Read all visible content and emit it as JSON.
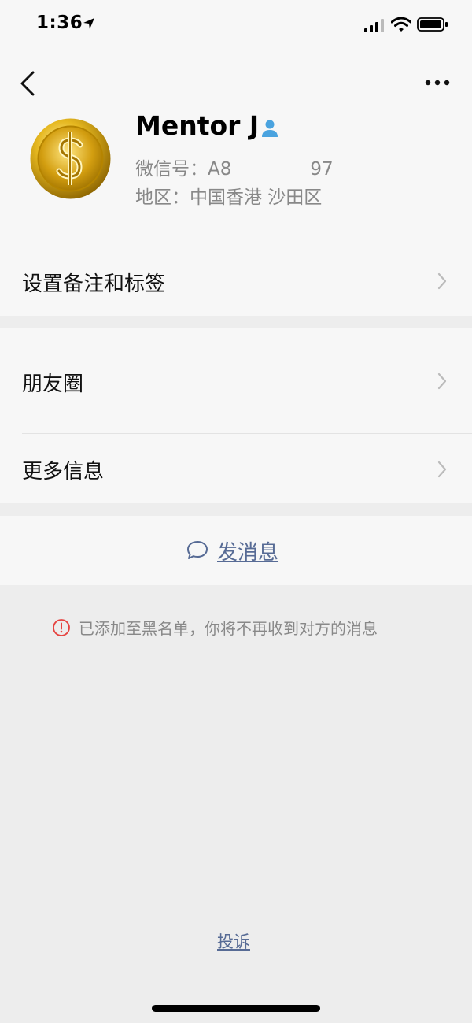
{
  "status_bar": {
    "time": "1:36"
  },
  "profile": {
    "name": "Mentor J",
    "wechat_id_label": "微信号：A8",
    "wechat_id_suffix": "97",
    "region": "地区：中国香港 沙田区"
  },
  "menu": {
    "remarks_tags": "设置备注和标签",
    "moments": "朋友圈",
    "more_info": "更多信息"
  },
  "actions": {
    "send_message": "发消息"
  },
  "notice": {
    "blacklist_text": "已添加至黑名单，你将不再收到对方的消息"
  },
  "footer": {
    "complain": "投诉"
  },
  "icons": {
    "back": "chevron-left-icon",
    "more": "more-dots-icon",
    "verify": "person-icon",
    "row_chevron": "chevron-right-icon",
    "chat": "chat-bubble-icon",
    "warning": "exclamation-circle-icon"
  },
  "colors": {
    "link": "#576b95",
    "warning": "#e64340",
    "verify": "#4aa3df",
    "avatar_gold": "#d4a017"
  }
}
